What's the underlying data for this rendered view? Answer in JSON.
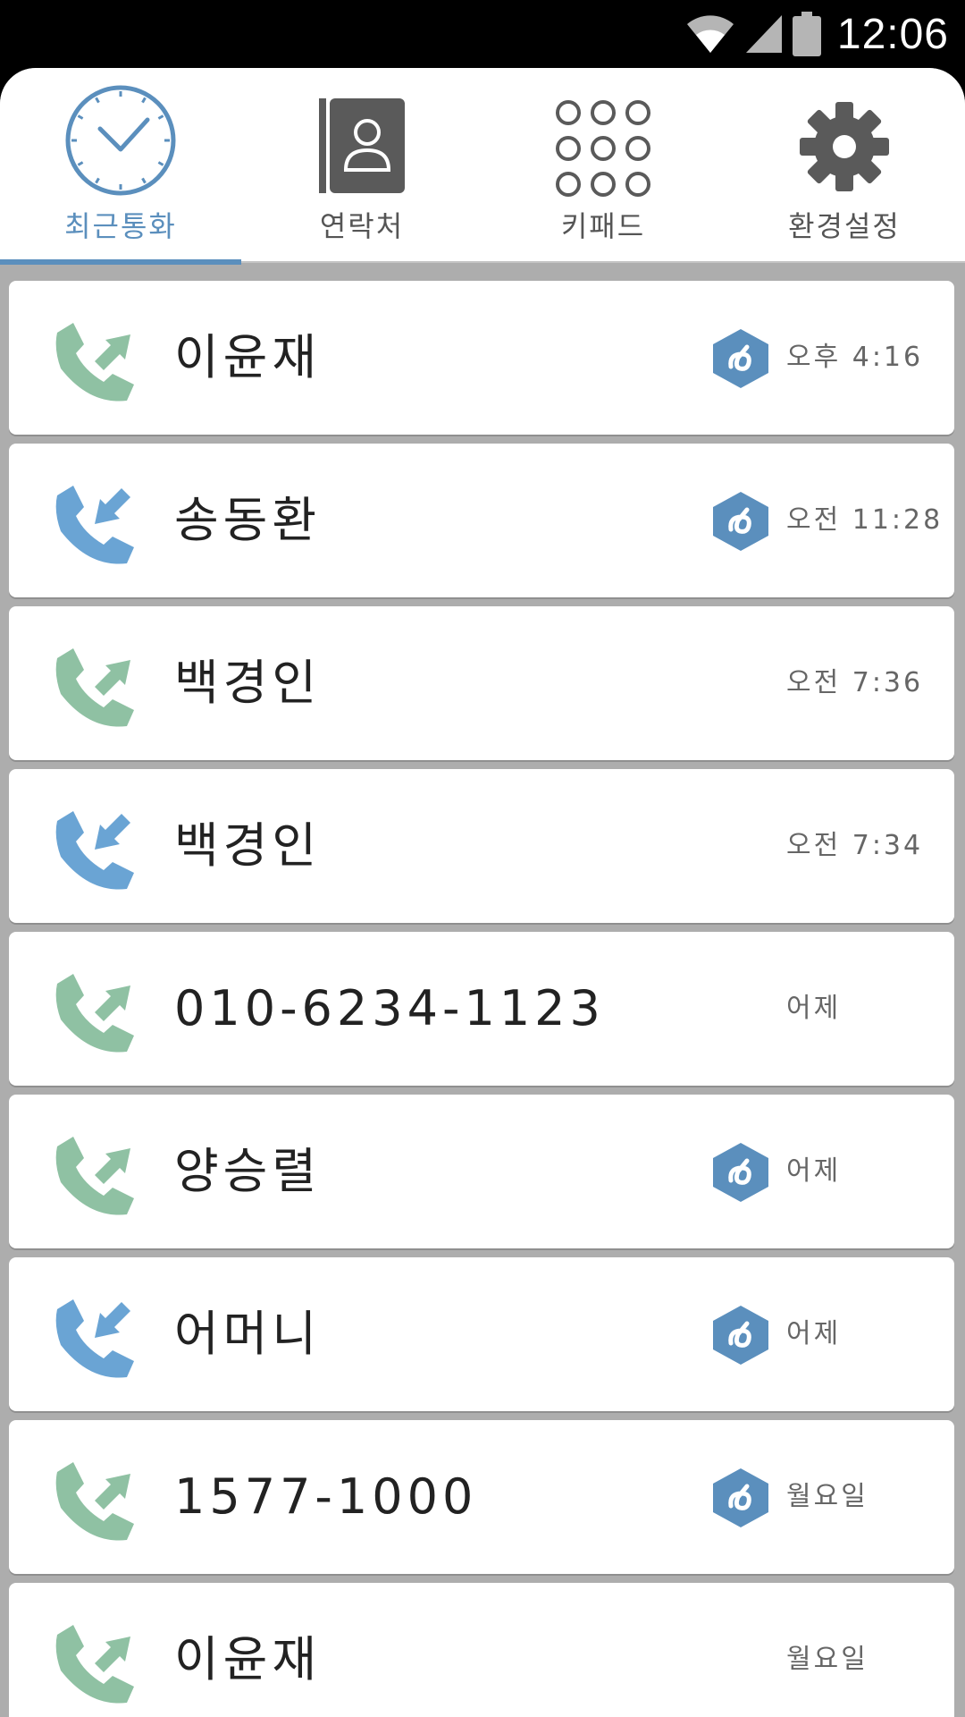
{
  "status_bar": {
    "time": "12:06",
    "icons": [
      "wifi-icon",
      "signal-icon",
      "battery-icon"
    ]
  },
  "colors": {
    "accent": "#5b8fbd",
    "outgoing": "#8fc1a3",
    "incoming": "#6aa4d4",
    "badge": "#5b8fbd"
  },
  "tabs": [
    {
      "label": "최근통화",
      "icon": "clock-icon",
      "active": true
    },
    {
      "label": "연락처",
      "icon": "contacts-book-icon",
      "active": false
    },
    {
      "label": "키패드",
      "icon": "keypad-icon",
      "active": false
    },
    {
      "label": "환경설정",
      "icon": "gear-icon",
      "active": false
    }
  ],
  "calls": [
    {
      "name": "이윤재",
      "time": "오후 4:16",
      "direction": "outgoing",
      "badge": true
    },
    {
      "name": "송동환",
      "time": "오전 11:28",
      "direction": "incoming",
      "badge": true
    },
    {
      "name": "백경인",
      "time": "오전 7:36",
      "direction": "outgoing",
      "badge": false
    },
    {
      "name": "백경인",
      "time": "오전 7:34",
      "direction": "incoming",
      "badge": false
    },
    {
      "name": "010-6234-1123",
      "time": "어제",
      "direction": "outgoing",
      "badge": false
    },
    {
      "name": "양승렬",
      "time": "어제",
      "direction": "outgoing",
      "badge": true
    },
    {
      "name": "어머니",
      "time": "어제",
      "direction": "incoming",
      "badge": true
    },
    {
      "name": "1577-1000",
      "time": "월요일",
      "direction": "outgoing",
      "badge": true
    },
    {
      "name": "이윤재",
      "time": "월요일",
      "direction": "outgoing",
      "badge": false
    }
  ]
}
